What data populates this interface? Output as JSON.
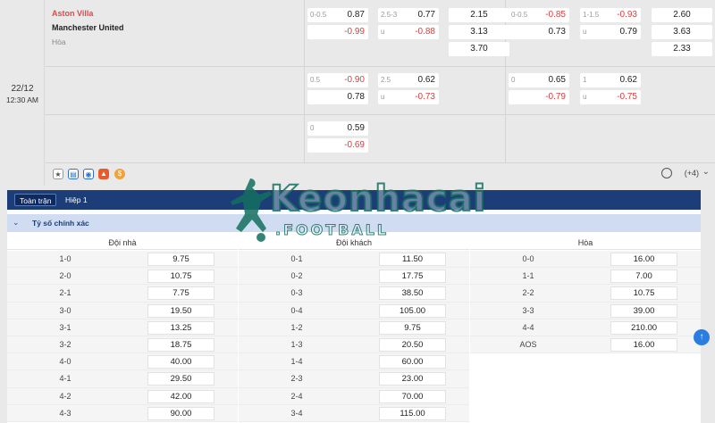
{
  "match": {
    "date": "22/12",
    "time": "12:30 AM",
    "home": "Aston Villa",
    "away": "Manchester United",
    "draw": "Hòa"
  },
  "odds_rows": [
    {
      "h1": {
        "line": "0-0.5",
        "home": "0.87",
        "away": "-0.99"
      },
      "ou1": {
        "line": "2.5-3",
        "over": "0.77",
        "under_label": "u",
        "under": "-0.88"
      },
      "x1": [
        "2.15",
        "3.13",
        "3.70"
      ],
      "h2": {
        "line": "0-0.5",
        "home": "-0.85",
        "away": "0.73"
      },
      "ou2": {
        "line": "1-1.5",
        "over": "-0.93",
        "under_label": "u",
        "under": "0.79"
      },
      "x2": [
        "2.60",
        "3.63",
        "2.33"
      ]
    },
    {
      "h1": {
        "line": "0.5",
        "home": "-0.90",
        "away": "0.78"
      },
      "ou1": {
        "line": "2.5",
        "over": "0.62",
        "under_label": "u",
        "under": "-0.73"
      },
      "h2": {
        "line": "0",
        "home": "0.65",
        "away": "-0.79"
      },
      "ou2": {
        "line": "1",
        "over": "0.62",
        "under_label": "u",
        "under": "-0.75"
      }
    },
    {
      "h1": {
        "line": "0",
        "home": "0.59",
        "away": "-0.69"
      }
    }
  ],
  "icons": {
    "more": "(+4)"
  },
  "tabs": [
    "Toàn trận",
    "Hiệp 1"
  ],
  "section_title": "Tỷ số chính xác",
  "columns": [
    {
      "header": "Đội nhà",
      "rows": [
        {
          "score": "1-0",
          "odds": "9.75"
        },
        {
          "score": "2-0",
          "odds": "10.75"
        },
        {
          "score": "2-1",
          "odds": "7.75"
        },
        {
          "score": "3-0",
          "odds": "19.50"
        },
        {
          "score": "3-1",
          "odds": "13.25"
        },
        {
          "score": "3-2",
          "odds": "18.75"
        },
        {
          "score": "4-0",
          "odds": "40.00"
        },
        {
          "score": "4-1",
          "odds": "29.50"
        },
        {
          "score": "4-2",
          "odds": "42.00"
        },
        {
          "score": "4-3",
          "odds": "90.00"
        }
      ]
    },
    {
      "header": "Đội khách",
      "rows": [
        {
          "score": "0-1",
          "odds": "11.50"
        },
        {
          "score": "0-2",
          "odds": "17.75"
        },
        {
          "score": "0-3",
          "odds": "38.50"
        },
        {
          "score": "0-4",
          "odds": "105.00"
        },
        {
          "score": "1-2",
          "odds": "9.75"
        },
        {
          "score": "1-3",
          "odds": "20.50"
        },
        {
          "score": "1-4",
          "odds": "60.00"
        },
        {
          "score": "2-3",
          "odds": "23.00"
        },
        {
          "score": "2-4",
          "odds": "70.00"
        },
        {
          "score": "3-4",
          "odds": "115.00"
        }
      ]
    },
    {
      "header": "Hòa",
      "rows": [
        {
          "score": "0-0",
          "odds": "16.00"
        },
        {
          "score": "1-1",
          "odds": "7.00"
        },
        {
          "score": "2-2",
          "odds": "10.75"
        },
        {
          "score": "3-3",
          "odds": "39.00"
        },
        {
          "score": "4-4",
          "odds": "210.00"
        },
        {
          "score": "AOS",
          "odds": "16.00"
        }
      ]
    }
  ],
  "watermark": {
    "brand": "Keonhacai",
    "sub": ".FOOTBALL"
  },
  "colors": {
    "header_blue": "#1d3d79",
    "negative_red": "#d64040",
    "home_red": "#e04848",
    "accent_blue": "#2b7de0"
  }
}
